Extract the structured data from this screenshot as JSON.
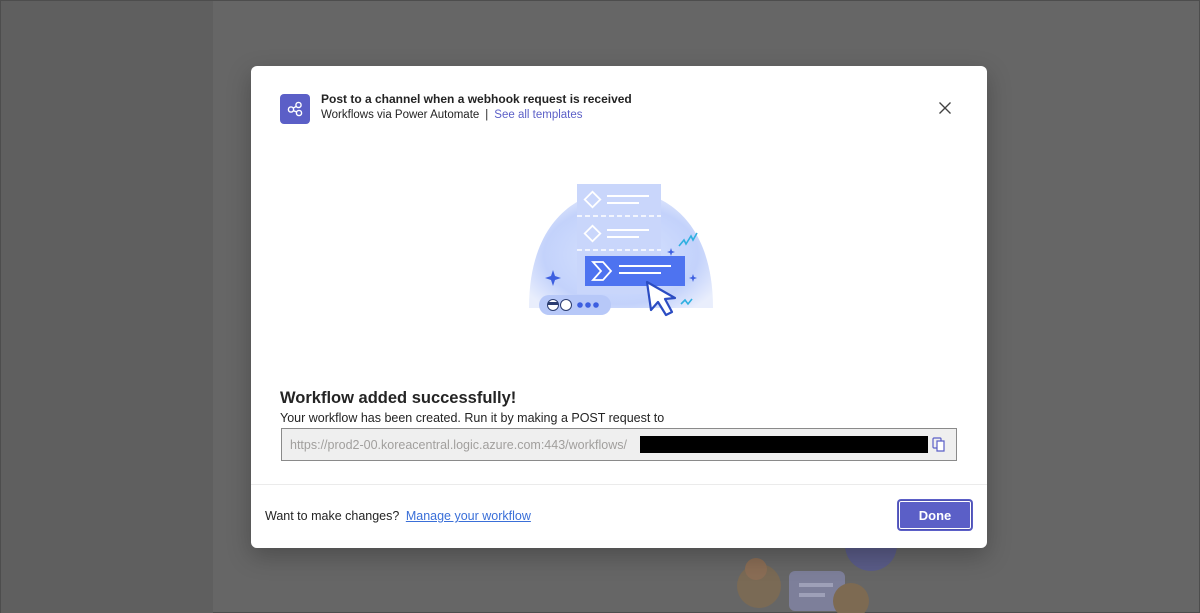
{
  "dialog": {
    "title": "Post to a channel when a webhook request is received",
    "subtitle": "Workflows via Power Automate",
    "separator": "|",
    "templates_link": "See all templates",
    "success_title": "Workflow added successfully!",
    "success_description": "Your workflow has been created. Run it by making a POST request to",
    "url_value": "https://prod2-00.koreacentral.logic.azure.com:443/workflows/",
    "footer_prompt": "Want to make changes?",
    "footer_link": "Manage your workflow",
    "done_label": "Done"
  },
  "icons": {
    "app": "share-nodes-icon",
    "close": "close-icon",
    "copy": "copy-icon"
  },
  "colors": {
    "accent": "#5b5fc7",
    "link": "#3a6fd8",
    "overlay": "#666666"
  }
}
